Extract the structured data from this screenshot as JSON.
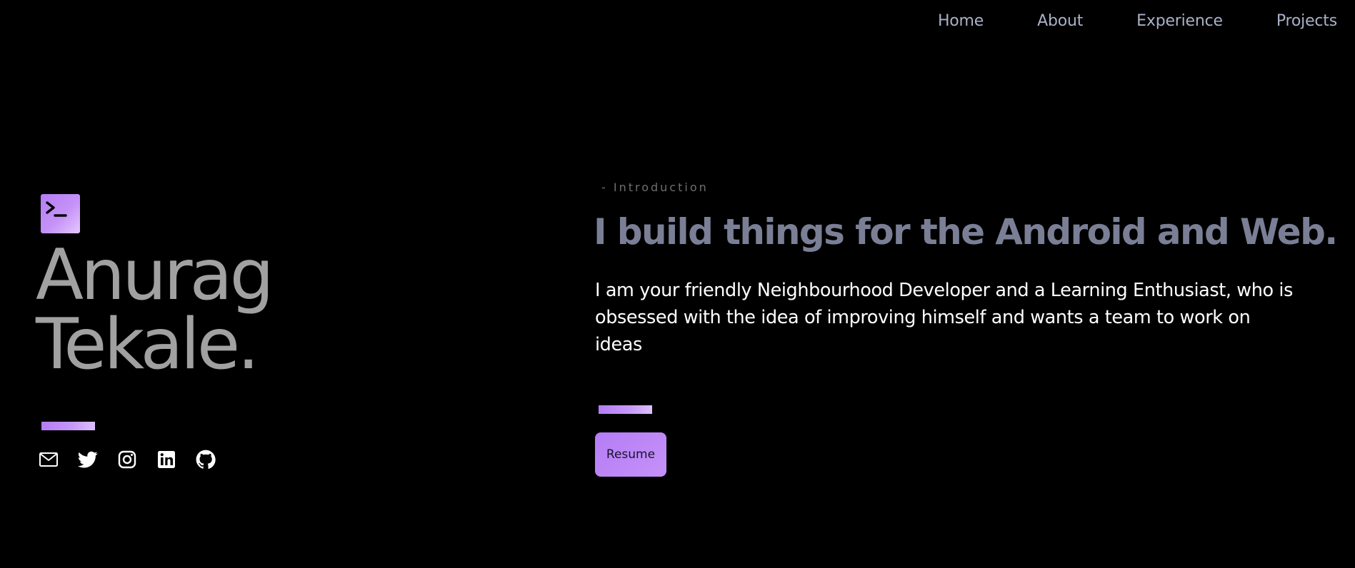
{
  "nav": {
    "items": [
      {
        "label": "Home"
      },
      {
        "label": "About"
      },
      {
        "label": "Experience"
      },
      {
        "label": "Projects"
      }
    ]
  },
  "hero": {
    "logo_icon": "terminal-icon",
    "name_line1": "Anurag",
    "name_line2": "Tekale.",
    "socials": [
      {
        "icon": "mail-icon"
      },
      {
        "icon": "twitter-icon"
      },
      {
        "icon": "instagram-icon"
      },
      {
        "icon": "linkedin-icon"
      },
      {
        "icon": "github-icon"
      }
    ]
  },
  "intro": {
    "label": "- Introduction",
    "headline": "I build things for the Android and Web.",
    "bio": "I am your friendly Neighbourhood Developer and a Learning Enthusiast, who is obsessed with the idea of improving himself and wants a team to work on ideas",
    "resume_label": "Resume"
  },
  "colors": {
    "background": "#000000",
    "accent": "#b57df5",
    "nav_text": "#aab0c8",
    "name_text": "#a1a1a1",
    "headline_text": "#7a7f96",
    "body_text": "#ffffff"
  }
}
